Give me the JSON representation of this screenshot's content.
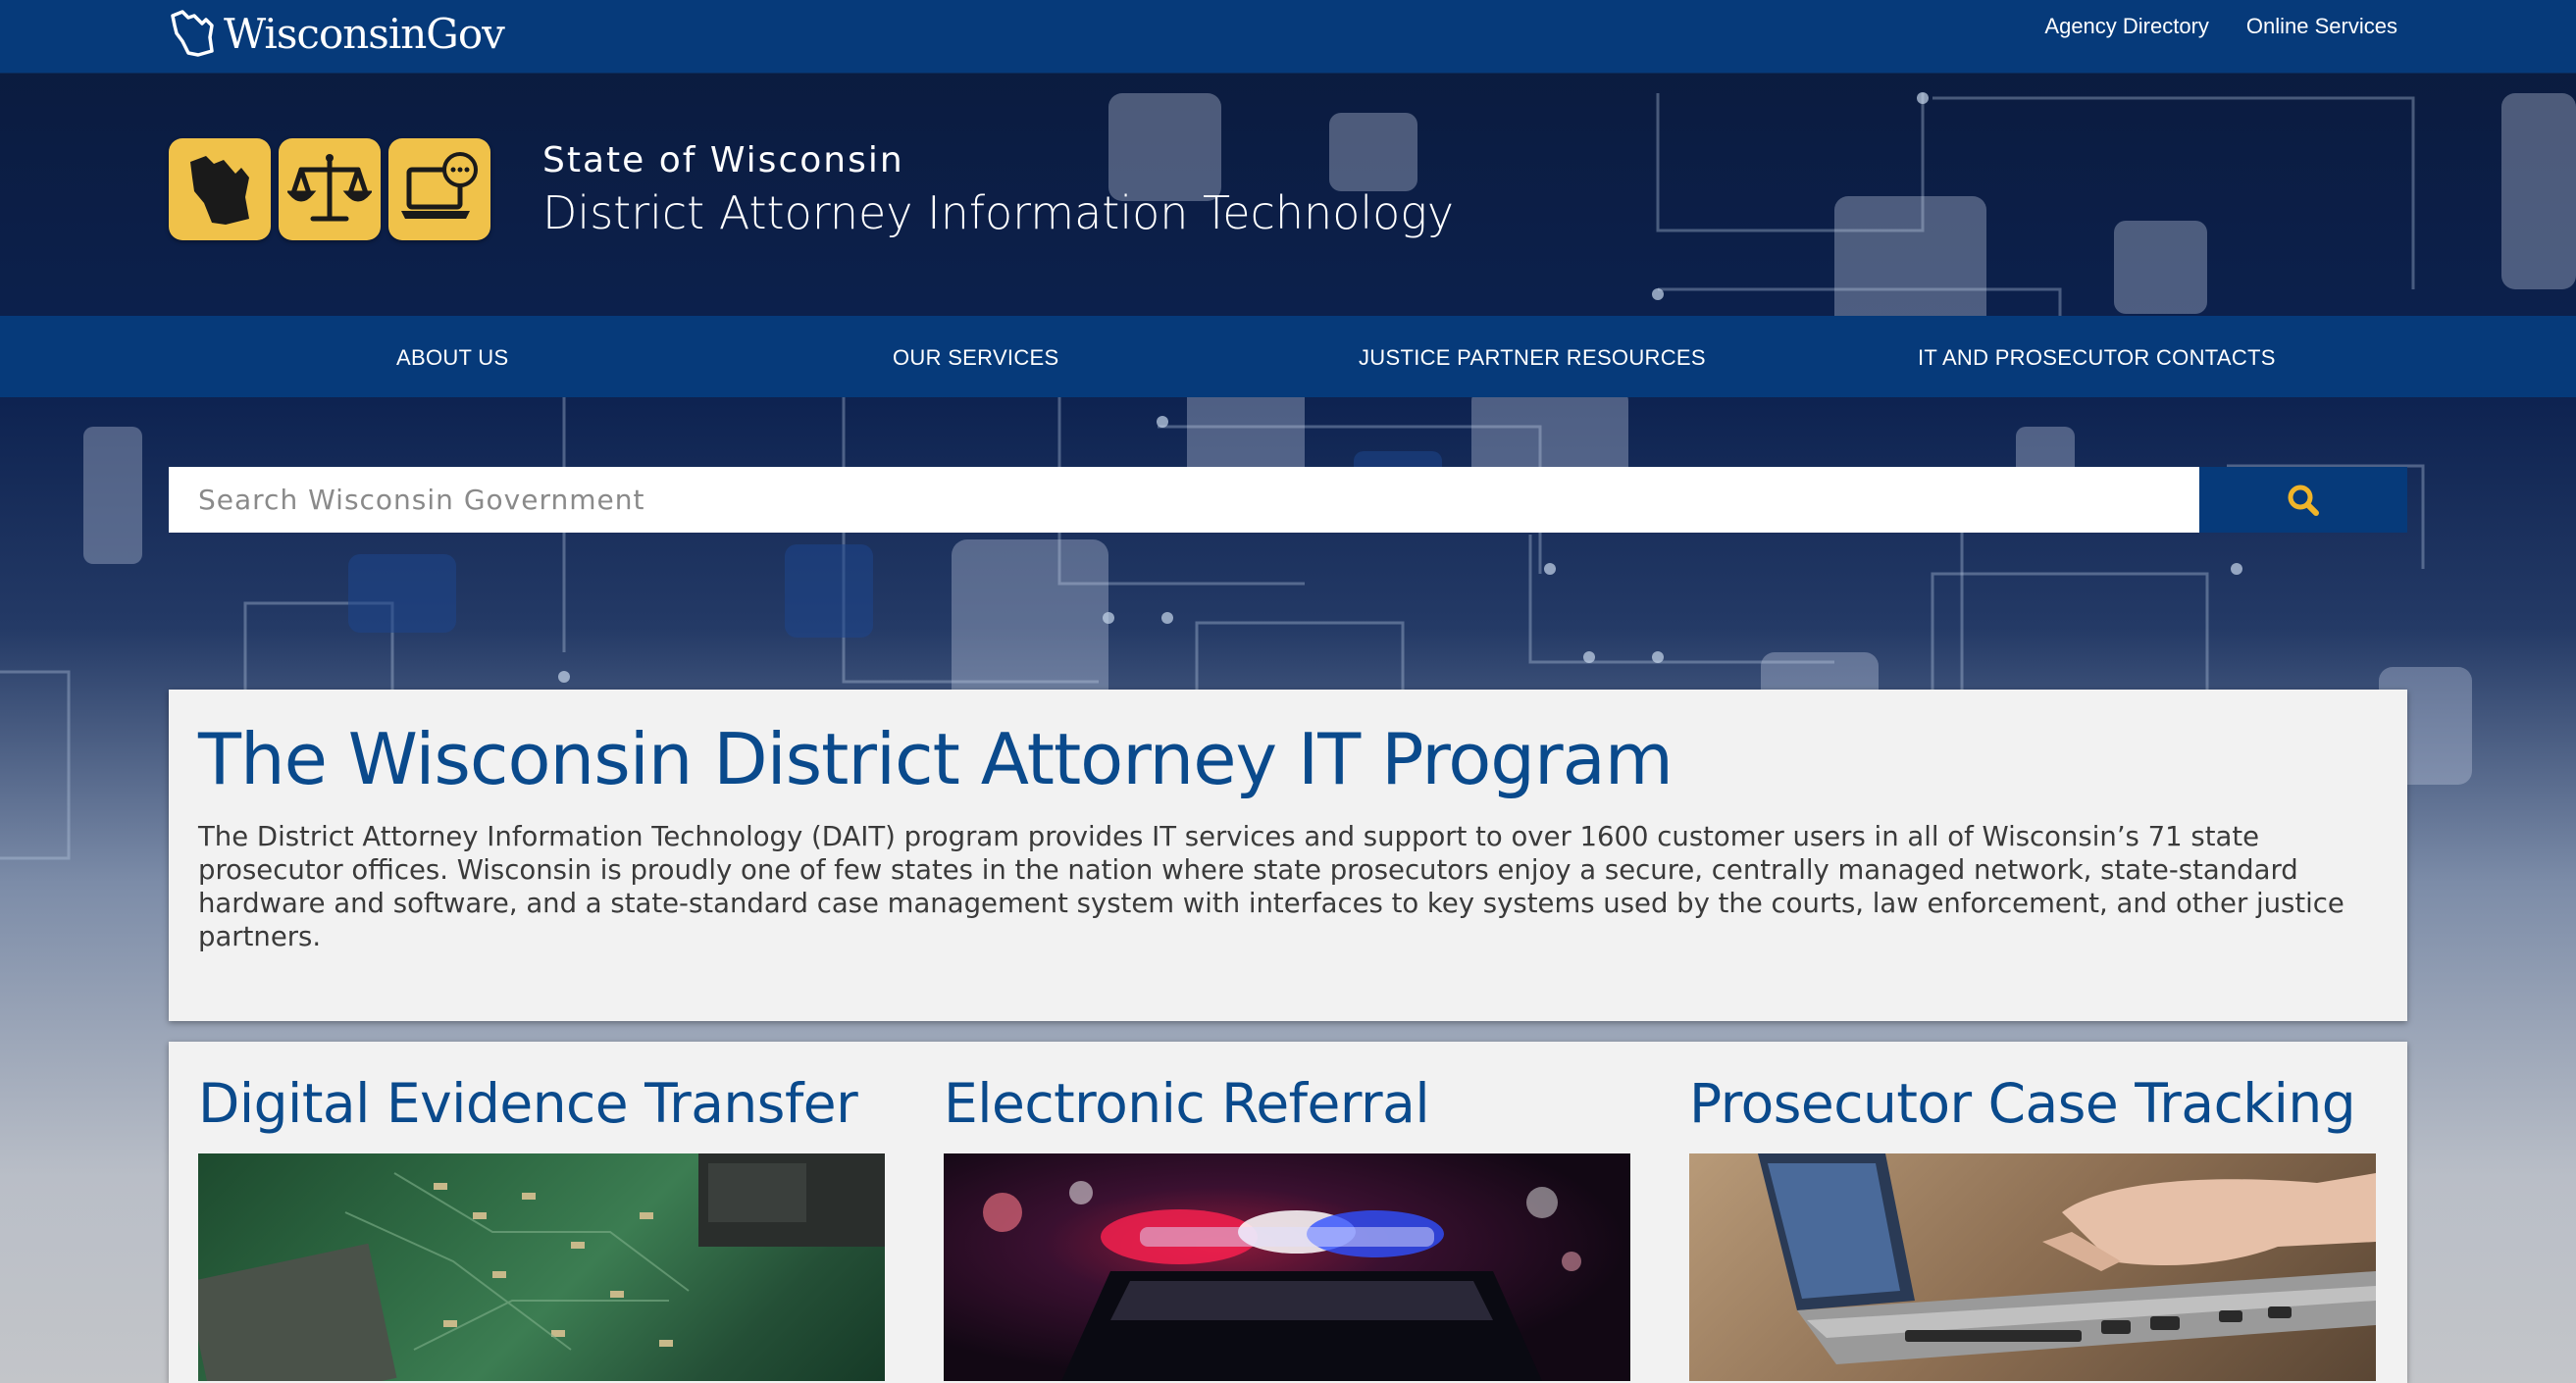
{
  "topbar": {
    "logo_text": "WisconsinGov",
    "links": [
      "Agency Directory",
      "Online Services"
    ]
  },
  "header": {
    "state": "State of Wisconsin",
    "agency": "District Attorney Information Technology",
    "badge_icons": [
      "wisconsin-map-icon",
      "scales-of-justice-icon",
      "laptop-chat-icon"
    ]
  },
  "nav": {
    "items": [
      "ABOUT US",
      "OUR SERVICES",
      "JUSTICE PARTNER RESOURCES",
      "IT AND PROSECUTOR CONTACTS"
    ]
  },
  "search": {
    "placeholder": "Search Wisconsin Government",
    "button_icon": "search-icon"
  },
  "intro": {
    "title": "The Wisconsin District Attorney IT Program",
    "body": "The District Attorney Information Technology (DAIT) program provides IT services and support to over 1600 customer users in all of Wisconsin’s 71 state prosecutor offices. Wisconsin is proudly one of few states in the nation where state prosecutors enjoy a secure, centrally managed network, state-standard hardware and software, and a state-standard case management system with interfaces to key systems used by the courts, law enforcement, and other justice partners."
  },
  "features": [
    {
      "title": "Digital Evidence Transfer",
      "image": "circuit-board-photo"
    },
    {
      "title": "Electronic Referral",
      "image": "police-lights-photo"
    },
    {
      "title": "Prosecutor Case Tracking",
      "image": "laptop-typing-photo"
    }
  ],
  "colors": {
    "primary_blue": "#063a7a",
    "heading_blue": "#0a4a8c",
    "badge_gold": "#f0c24a",
    "card_bg": "#f2f2f2"
  }
}
